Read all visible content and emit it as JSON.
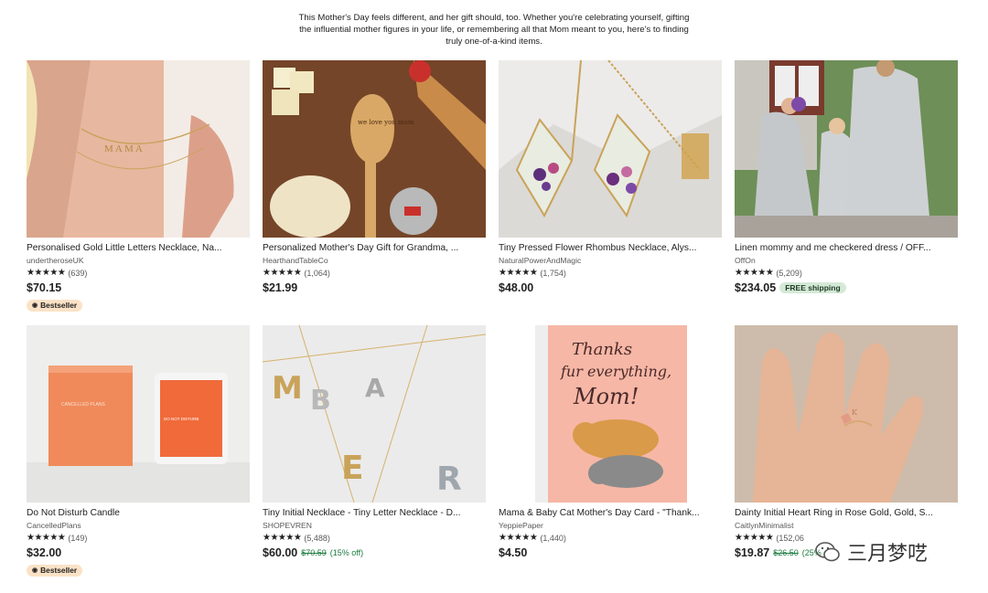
{
  "page": {
    "intro": "This Mother's Day feels different, and her gift should, too. Whether you're celebrating yourself, gifting the influential mother figures in your life, or remembering all that Mom meant to you, here's to finding truly one-of-a-kind items."
  },
  "stars": "★★★★★",
  "products": [
    {
      "title": "Personalised Gold Little Letters Necklace, Na...",
      "shop": "undertheroseUK",
      "reviews": "(639)",
      "price": "$70.15",
      "badge": "Bestseller"
    },
    {
      "title": "Personalized Mother's Day Gift for Grandma, ...",
      "shop": "HearthandTableCo",
      "reviews": "(1,064)",
      "price": "$21.99"
    },
    {
      "title": "Tiny Pressed Flower Rhombus Necklace, Alys...",
      "shop": "NaturalPowerAndMagic",
      "reviews": "(1,754)",
      "price": "$48.00"
    },
    {
      "title": "Linen mommy and me checkered dress / OFF...",
      "shop": "OffOn",
      "reviews": "(5,209)",
      "price": "$234.05",
      "shipping": "FREE shipping"
    },
    {
      "title": "Do Not Disturb Candle",
      "shop": "CancelledPlans",
      "reviews": "(149)",
      "price": "$32.00",
      "badge": "Bestseller"
    },
    {
      "title": "Tiny Initial Necklace - Tiny Letter Necklace - D...",
      "shop": "SHOPEVREN",
      "reviews": "(5,488)",
      "price": "$60.00",
      "original_price": "$70.59",
      "discount": "(15% off)"
    },
    {
      "title": "Mama & Baby Cat Mother's Day Card - \"Thank...",
      "shop": "YeppiePaper",
      "reviews": "(1,440)",
      "price": "$4.50"
    },
    {
      "title": "Dainty Initial Heart Ring in Rose Gold, Gold, S...",
      "shop": "CaitlynMinimalist",
      "reviews": "(152,06",
      "price": "$19.87",
      "original_price": "$26.50",
      "discount": "(25% o"
    }
  ],
  "images": {
    "candle_box_text": "CANCELLED PLANS",
    "candle_jar_text": "DO NOT DISTURB",
    "spoon_text": "we love you mom",
    "card_text_1": "Thanks",
    "card_text_2": "fur everything,",
    "card_text_3": "Mom!",
    "necklace_letters": "M A M A"
  },
  "watermark": {
    "text": "三月梦呓",
    "icon": "wechat-icon"
  },
  "colors": {
    "bestseller_bg": "#fbe2c6",
    "free_shipping_bg": "#d4e9d7",
    "sale_green": "#1b7a3e"
  }
}
